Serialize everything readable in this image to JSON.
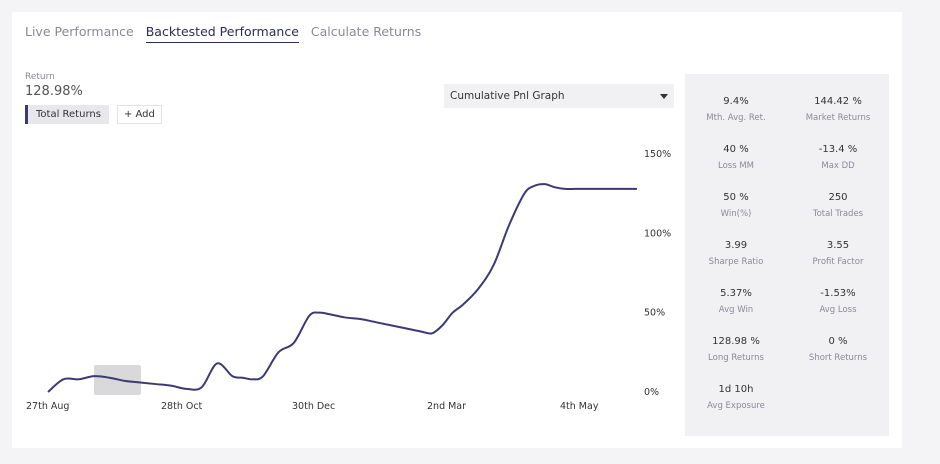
{
  "tabs": [
    {
      "label": "Live Performance"
    },
    {
      "label": "Backtested Performance"
    },
    {
      "label": "Calculate Returns"
    }
  ],
  "returns": {
    "label": "Return",
    "value": "128.98%",
    "series_pill": "Total Returns",
    "add_label": "+ Add"
  },
  "dropdown": {
    "selected": "Cumulative Pnl Graph"
  },
  "stats": [
    {
      "value": "9.4%",
      "label": "Mth. Avg. Ret."
    },
    {
      "value": "144.42 %",
      "label": "Market Returns"
    },
    {
      "value": "40 %",
      "label": "Loss MM"
    },
    {
      "value": "-13.4 %",
      "label": "Max DD"
    },
    {
      "value": "50 %",
      "label": "Win(%)"
    },
    {
      "value": "250",
      "label": "Total Trades"
    },
    {
      "value": "3.99",
      "label": "Sharpe Ratio"
    },
    {
      "value": "3.55",
      "label": "Profit Factor"
    },
    {
      "value": "5.37%",
      "label": "Avg Win"
    },
    {
      "value": "-1.53%",
      "label": "Avg Loss"
    },
    {
      "value": "128.98 %",
      "label": "Long Returns"
    },
    {
      "value": "0 %",
      "label": "Short Returns"
    },
    {
      "value": "1d 10h",
      "label": "Avg Exposure"
    }
  ],
  "colors": {
    "line": "#3c3a73",
    "accent": "#2c2c5a",
    "panel": "#f1f1f3"
  },
  "chart_data": {
    "type": "line",
    "x": [
      0,
      15,
      30,
      45,
      60,
      75,
      90,
      105,
      120,
      135,
      150,
      165,
      180,
      190,
      200,
      210,
      225,
      240,
      255,
      265,
      275,
      290,
      305,
      320,
      335,
      350,
      365,
      375,
      385,
      395,
      405,
      420,
      435,
      450,
      465,
      475,
      485,
      495,
      505,
      515,
      525,
      535,
      545,
      555,
      565,
      575
    ],
    "series": [
      {
        "values": [
          0,
          8,
          8,
          10,
          9,
          7,
          6,
          5,
          4,
          2,
          3,
          18,
          10,
          9,
          8,
          10,
          25,
          31,
          48,
          50,
          49,
          47,
          46,
          44,
          42,
          40,
          38,
          37,
          42,
          50,
          55,
          65,
          80,
          105,
          125,
          130,
          131,
          129,
          128,
          128,
          128,
          128,
          128,
          128,
          128,
          128
        ]
      }
    ],
    "x_tick_labels": [
      "27th Aug",
      "28th Oct",
      "30th Dec",
      "2nd Mar",
      "4th May"
    ],
    "y_tick_labels": [
      "150%",
      "100%",
      "50%",
      "0%"
    ],
    "ylim": [
      0,
      150
    ]
  }
}
